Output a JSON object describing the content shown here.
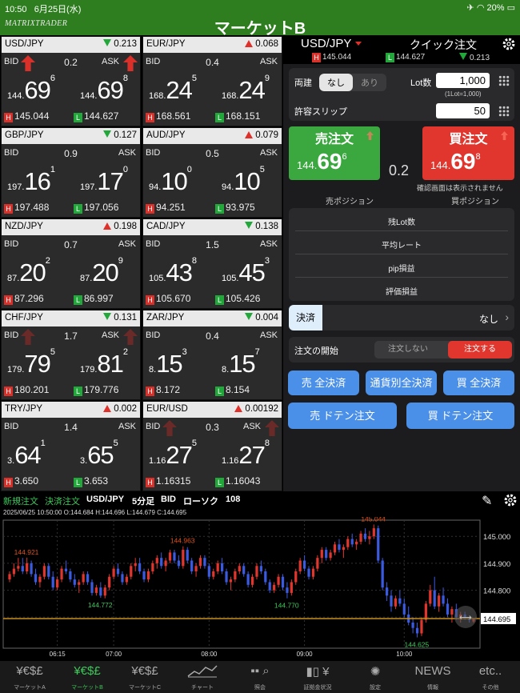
{
  "status": {
    "time": "10:50",
    "date": "6月25日(水)",
    "battery": "20%"
  },
  "app": {
    "logo": "MATRIXTRADER",
    "title": "マーケットB"
  },
  "labels": {
    "bid": "BID",
    "ask": "ASK"
  },
  "tiles": [
    {
      "pair": "USD/JPY",
      "dir": "down",
      "change": "0.213",
      "spread": "0.2",
      "bid_arrow": "up",
      "ask_arrow": "up",
      "bid_small": "144.",
      "bid_big": "69",
      "bid_pip": "6",
      "ask_small": "144.",
      "ask_big": "69",
      "ask_pip": "8",
      "high": "145.044",
      "low": "144.627"
    },
    {
      "pair": "EUR/JPY",
      "dir": "up",
      "change": "0.068",
      "spread": "0.4",
      "bid_arrow": "",
      "ask_arrow": "",
      "bid_small": "168.",
      "bid_big": "24",
      "bid_pip": "5",
      "ask_small": "168.",
      "ask_big": "24",
      "ask_pip": "9",
      "high": "168.561",
      "low": "168.151"
    },
    {
      "pair": "GBP/JPY",
      "dir": "down",
      "change": "0.127",
      "spread": "0.9",
      "bid_arrow": "",
      "ask_arrow": "",
      "bid_small": "197.",
      "bid_big": "16",
      "bid_pip": "1",
      "ask_small": "197.",
      "ask_big": "17",
      "ask_pip": "0",
      "high": "197.488",
      "low": "197.056"
    },
    {
      "pair": "AUD/JPY",
      "dir": "up",
      "change": "0.079",
      "spread": "0.5",
      "bid_arrow": "",
      "ask_arrow": "",
      "bid_small": "94.",
      "bid_big": "10",
      "bid_pip": "0",
      "ask_small": "94.",
      "ask_big": "10",
      "ask_pip": "5",
      "high": "94.251",
      "low": "93.975"
    },
    {
      "pair": "NZD/JPY",
      "dir": "up",
      "change": "0.198",
      "spread": "0.7",
      "bid_arrow": "",
      "ask_arrow": "",
      "bid_small": "87.",
      "bid_big": "20",
      "bid_pip": "2",
      "ask_small": "87.",
      "ask_big": "20",
      "ask_pip": "9",
      "high": "87.296",
      "low": "86.997"
    },
    {
      "pair": "CAD/JPY",
      "dir": "down",
      "change": "0.138",
      "spread": "1.5",
      "bid_arrow": "",
      "ask_arrow": "",
      "bid_small": "105.",
      "bid_big": "43",
      "bid_pip": "8",
      "ask_small": "105.",
      "ask_big": "45",
      "ask_pip": "3",
      "high": "105.670",
      "low": "105.426"
    },
    {
      "pair": "CHF/JPY",
      "dir": "down",
      "change": "0.131",
      "spread": "1.7",
      "bid_arrow": "dim",
      "ask_arrow": "dim",
      "bid_small": "179.",
      "bid_big": "79",
      "bid_pip": "5",
      "ask_small": "179.",
      "ask_big": "81",
      "ask_pip": "2",
      "high": "180.201",
      "low": "179.776"
    },
    {
      "pair": "ZAR/JPY",
      "dir": "down",
      "change": "0.004",
      "spread": "0.4",
      "bid_arrow": "",
      "ask_arrow": "",
      "bid_small": "8.",
      "bid_big": "15",
      "bid_pip": "3",
      "ask_small": "8.",
      "ask_big": "15",
      "ask_pip": "7",
      "high": "8.172",
      "low": "8.154"
    },
    {
      "pair": "TRY/JPY",
      "dir": "up",
      "change": "0.002",
      "spread": "1.4",
      "bid_arrow": "",
      "ask_arrow": "",
      "bid_small": "3.",
      "bid_big": "64",
      "bid_pip": "1",
      "ask_small": "3.",
      "ask_big": "65",
      "ask_pip": "5",
      "high": "3.650",
      "low": "3.653"
    },
    {
      "pair": "EUR/USD",
      "dir": "up",
      "change": "0.00192",
      "spread": "0.3",
      "bid_arrow": "dim",
      "ask_arrow": "dim",
      "bid_small": "1.16",
      "bid_big": "27",
      "bid_pip": "5",
      "ask_small": "1.16",
      "ask_big": "27",
      "ask_pip": "8",
      "high": "1.16315",
      "low": "1.16043"
    }
  ],
  "order": {
    "pair": "USD/JPY",
    "quick": "クイック注文",
    "high": "145.044",
    "low": "144.627",
    "change": "0.213",
    "both_label": "両建",
    "both_off": "なし",
    "both_on": "あり",
    "lot_label": "Lot数",
    "lot_value": "1,000",
    "lot_note": "(1Lot=1,000)",
    "slip_label": "許容スリップ",
    "slip_value": "50",
    "sell_title": "売注文",
    "sell_small": "144.",
    "sell_big": "69",
    "sell_pip": "6",
    "buy_title": "買注文",
    "buy_small": "144.",
    "buy_big": "69",
    "buy_pip": "8",
    "spread": "0.2",
    "confirm_note": "確認画面は表示されません",
    "sell_pos": "売ポジション",
    "buy_pos": "買ポジション",
    "rows": [
      "残Lot数",
      "平均レート",
      "pip損益",
      "評価損益"
    ],
    "settle_label": "決済",
    "settle_value": "なし",
    "start_label": "注文の開始",
    "start_off": "注文しない",
    "start_on": "注文する",
    "btn_sell_all": "売 全決済",
    "btn_pair_all": "通貨別全決済",
    "btn_buy_all": "買 全決済",
    "btn_sell_doten": "売 ドテン注文",
    "btn_buy_doten": "買 ドテン注文"
  },
  "chart_toolbar": {
    "new_order": "新規注文",
    "settle_order": "決済注文",
    "pair": "USD/JPY",
    "interval": "5分足",
    "side": "BID",
    "type": "ローソク",
    "count": "108"
  },
  "chart_info": "2025/06/25 10:50:00   O:144.684  H:144.696  L:144.679  C:144.695",
  "chart_data": {
    "type": "candlestick",
    "ylim": [
      144.585,
      145.06
    ],
    "yticks": [
      "145.000",
      "144.900",
      "144.800",
      "144.700"
    ],
    "ytick_values": [
      145.0,
      144.9,
      144.8,
      144.7
    ],
    "xticks": [
      "06:15",
      "07:00",
      "08:00",
      "09:00",
      "10:00"
    ],
    "xtick_index": [
      11,
      24,
      46,
      68,
      91
    ],
    "current_price": "144.695",
    "annotations": [
      {
        "text": "144.921",
        "i": 4,
        "v": 144.921,
        "color": "#e0501a"
      },
      {
        "text": "144.963",
        "i": 40,
        "v": 144.963,
        "color": "#e0501a"
      },
      {
        "text": "145.044",
        "i": 84,
        "v": 145.044,
        "color": "#e0501a"
      },
      {
        "text": "144.772",
        "i": 21,
        "v": 144.772,
        "color": "#3cc85a"
      },
      {
        "text": "144.770",
        "i": 64,
        "v": 144.77,
        "color": "#3cc85a"
      },
      {
        "text": "144.625",
        "i": 94,
        "v": 144.625,
        "color": "#3cc85a"
      }
    ],
    "ohlc": [
      [
        144.84,
        144.87,
        144.83,
        144.86
      ],
      [
        144.86,
        144.9,
        144.85,
        144.88
      ],
      [
        144.88,
        144.92,
        144.87,
        144.89
      ],
      [
        144.89,
        144.92,
        144.86,
        144.87
      ],
      [
        144.87,
        144.921,
        144.86,
        144.9
      ],
      [
        144.9,
        144.91,
        144.85,
        144.86
      ],
      [
        144.86,
        144.88,
        144.82,
        144.83
      ],
      [
        144.83,
        144.86,
        144.81,
        144.85
      ],
      [
        144.85,
        144.9,
        144.84,
        144.89
      ],
      [
        144.89,
        144.9,
        144.84,
        144.85
      ],
      [
        144.85,
        144.87,
        144.8,
        144.81
      ],
      [
        144.81,
        144.85,
        144.8,
        144.84
      ],
      [
        144.84,
        144.89,
        144.83,
        144.88
      ],
      [
        144.88,
        144.91,
        144.86,
        144.87
      ],
      [
        144.87,
        144.88,
        144.83,
        144.84
      ],
      [
        144.84,
        144.86,
        144.81,
        144.82
      ],
      [
        144.82,
        144.84,
        144.79,
        144.83
      ],
      [
        144.83,
        144.87,
        144.82,
        144.86
      ],
      [
        144.86,
        144.87,
        144.82,
        144.83
      ],
      [
        144.83,
        144.84,
        144.78,
        144.79
      ],
      [
        144.79,
        144.82,
        144.78,
        144.81
      ],
      [
        144.81,
        144.83,
        144.772,
        144.78
      ],
      [
        144.78,
        144.82,
        144.77,
        144.81
      ],
      [
        144.81,
        144.86,
        144.8,
        144.85
      ],
      [
        144.85,
        144.89,
        144.84,
        144.88
      ],
      [
        144.88,
        144.9,
        144.85,
        144.86
      ],
      [
        144.86,
        144.87,
        144.82,
        144.83
      ],
      [
        144.83,
        144.86,
        144.82,
        144.85
      ],
      [
        144.85,
        144.9,
        144.84,
        144.89
      ],
      [
        144.89,
        144.92,
        144.87,
        144.9
      ],
      [
        144.9,
        144.92,
        144.86,
        144.87
      ],
      [
        144.87,
        144.88,
        144.83,
        144.84
      ],
      [
        144.84,
        144.88,
        144.83,
        144.87
      ],
      [
        144.87,
        144.91,
        144.86,
        144.9
      ],
      [
        144.9,
        144.93,
        144.88,
        144.92
      ],
      [
        144.92,
        144.94,
        144.88,
        144.89
      ],
      [
        144.89,
        144.92,
        144.87,
        144.91
      ],
      [
        144.91,
        144.95,
        144.9,
        144.94
      ],
      [
        144.94,
        144.95,
        144.9,
        144.91
      ],
      [
        144.91,
        144.93,
        144.88,
        144.89
      ],
      [
        144.89,
        144.963,
        144.88,
        144.95
      ],
      [
        144.95,
        144.96,
        144.9,
        144.91
      ],
      [
        144.91,
        144.92,
        144.86,
        144.87
      ],
      [
        144.87,
        144.9,
        144.85,
        144.89
      ],
      [
        144.89,
        144.93,
        144.88,
        144.92
      ],
      [
        144.92,
        144.93,
        144.88,
        144.89
      ],
      [
        144.89,
        144.9,
        144.84,
        144.85
      ],
      [
        144.85,
        144.88,
        144.84,
        144.87
      ],
      [
        144.87,
        144.91,
        144.86,
        144.9
      ],
      [
        144.9,
        144.92,
        144.86,
        144.87
      ],
      [
        144.87,
        144.88,
        144.82,
        144.83
      ],
      [
        144.83,
        144.85,
        144.8,
        144.84
      ],
      [
        144.84,
        144.88,
        144.83,
        144.87
      ],
      [
        144.87,
        144.9,
        144.86,
        144.89
      ],
      [
        144.89,
        144.9,
        144.85,
        144.86
      ],
      [
        144.86,
        144.87,
        144.81,
        144.82
      ],
      [
        144.82,
        144.86,
        144.81,
        144.85
      ],
      [
        144.85,
        144.9,
        144.84,
        144.89
      ],
      [
        144.89,
        144.91,
        144.86,
        144.87
      ],
      [
        144.87,
        144.88,
        144.82,
        144.83
      ],
      [
        144.83,
        144.84,
        144.79,
        144.8
      ],
      [
        144.8,
        144.83,
        144.79,
        144.82
      ],
      [
        144.82,
        144.86,
        144.81,
        144.85
      ],
      [
        144.85,
        144.86,
        144.8,
        144.81
      ],
      [
        144.81,
        144.83,
        144.77,
        144.79
      ],
      [
        144.79,
        144.84,
        144.78,
        144.83
      ],
      [
        144.83,
        144.88,
        144.82,
        144.87
      ],
      [
        144.87,
        144.92,
        144.86,
        144.91
      ],
      [
        144.91,
        144.93,
        144.87,
        144.88
      ],
      [
        144.88,
        144.89,
        144.84,
        144.85
      ],
      [
        144.85,
        144.89,
        144.84,
        144.88
      ],
      [
        144.88,
        144.93,
        144.87,
        144.92
      ],
      [
        144.92,
        144.96,
        144.9,
        144.95
      ],
      [
        144.95,
        144.96,
        144.91,
        144.92
      ],
      [
        144.92,
        144.95,
        144.91,
        144.94
      ],
      [
        144.94,
        144.98,
        144.93,
        144.97
      ],
      [
        144.97,
        144.99,
        144.94,
        144.95
      ],
      [
        144.95,
        144.97,
        144.92,
        144.96
      ],
      [
        144.96,
        145.0,
        144.95,
        144.99
      ],
      [
        144.99,
        145.01,
        144.96,
        144.97
      ],
      [
        144.97,
        144.99,
        144.95,
        144.98
      ],
      [
        144.98,
        145.02,
        144.97,
        145.01
      ],
      [
        145.01,
        145.03,
        144.98,
        144.99
      ],
      [
        144.99,
        145.02,
        144.97,
        145.0
      ],
      [
        145.0,
        145.044,
        144.99,
        145.03
      ],
      [
        145.03,
        145.04,
        144.9,
        144.91
      ],
      [
        144.91,
        144.92,
        144.8,
        144.81
      ],
      [
        144.81,
        144.83,
        144.76,
        144.78
      ],
      [
        144.78,
        144.8,
        144.72,
        144.74
      ],
      [
        144.74,
        144.78,
        144.73,
        144.77
      ],
      [
        144.77,
        144.8,
        144.74,
        144.75
      ],
      [
        144.75,
        144.77,
        144.7,
        144.71
      ],
      [
        144.71,
        144.74,
        144.67,
        144.68
      ],
      [
        144.68,
        144.7,
        144.64,
        144.66
      ],
      [
        144.66,
        144.68,
        144.625,
        144.64
      ],
      [
        144.64,
        144.7,
        144.63,
        144.69
      ],
      [
        144.69,
        144.76,
        144.68,
        144.75
      ],
      [
        144.75,
        144.82,
        144.74,
        144.8
      ],
      [
        144.8,
        144.85,
        144.73,
        144.74
      ],
      [
        144.74,
        144.79,
        144.72,
        144.78
      ],
      [
        144.78,
        144.81,
        144.74,
        144.75
      ],
      [
        144.75,
        144.77,
        144.7,
        144.71
      ],
      [
        144.71,
        144.74,
        144.68,
        144.73
      ],
      [
        144.73,
        144.75,
        144.69,
        144.7
      ],
      [
        144.7,
        144.72,
        144.68,
        144.71
      ],
      [
        144.71,
        144.72,
        144.69,
        144.7
      ],
      [
        144.7,
        144.7,
        144.68,
        144.69
      ],
      [
        144.684,
        144.696,
        144.679,
        144.695
      ]
    ]
  },
  "bottom_tabs": [
    {
      "icon": "¥€$£",
      "label": "マーケットA"
    },
    {
      "icon": "¥€$£",
      "label": "マーケットB"
    },
    {
      "icon": "¥€$£",
      "label": "マーケットC"
    },
    {
      "icon": "",
      "label": "チャート"
    },
    {
      "icon": "",
      "label": "照会"
    },
    {
      "icon": "¥",
      "label": "証拠金状況"
    },
    {
      "icon": "",
      "label": "設定"
    },
    {
      "icon": "NEWS",
      "label": "情報"
    },
    {
      "icon": "etc..",
      "label": "その他"
    }
  ],
  "colors": {
    "brand_green": "#2e7d1f",
    "sell_green": "#3aa83f",
    "buy_red": "#e0362d",
    "blue_button": "#4a8fe8",
    "candle_up": "#e0362d",
    "candle_down": "#3a5ae0"
  }
}
